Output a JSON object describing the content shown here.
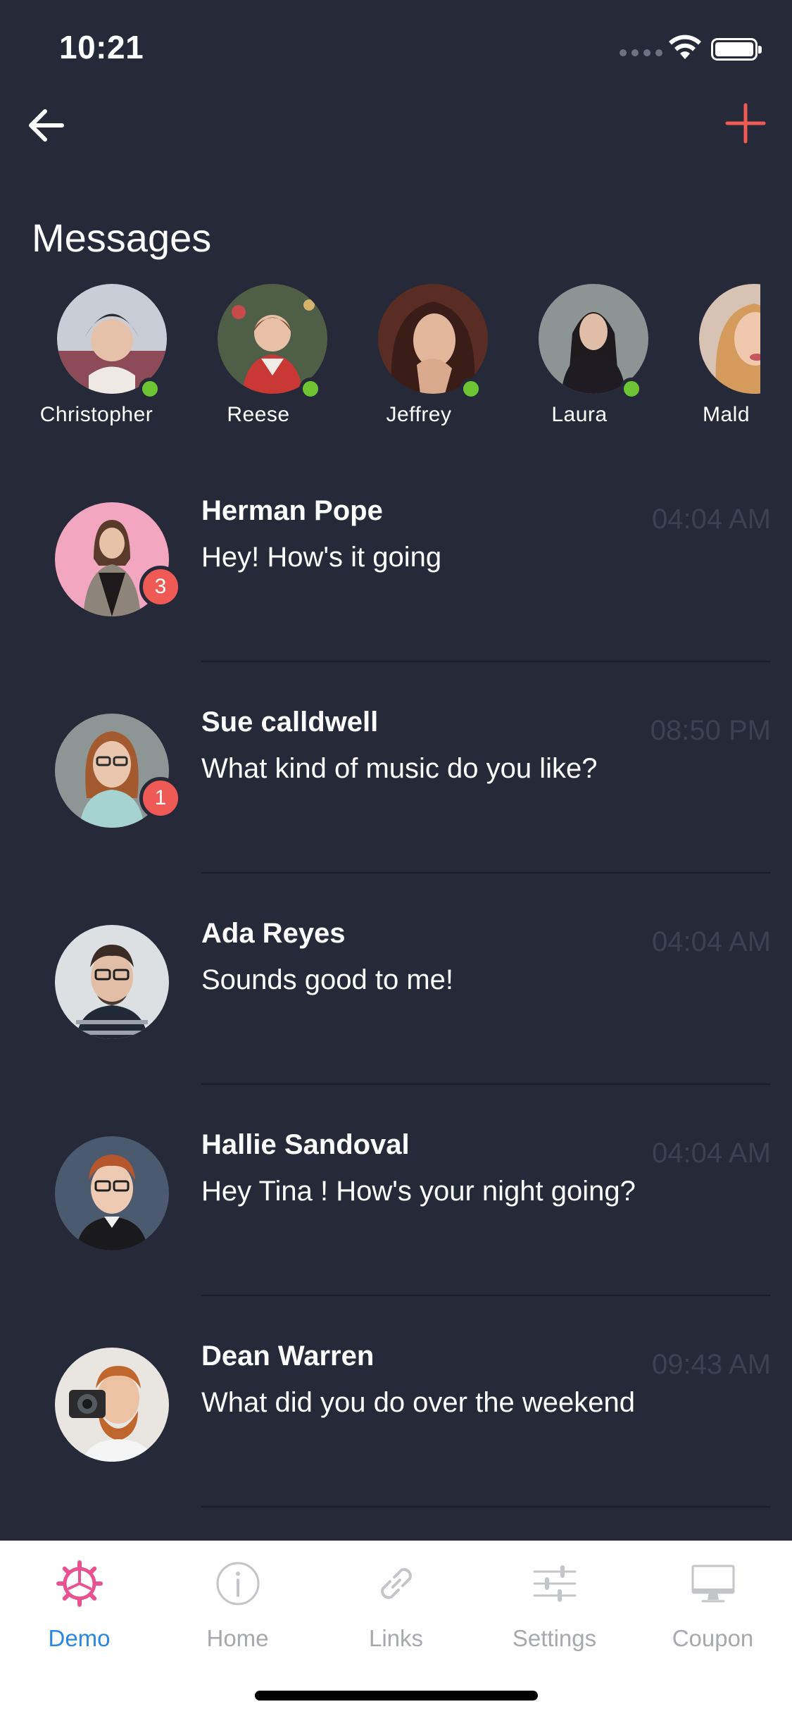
{
  "status_bar": {
    "time": "10:21"
  },
  "header": {
    "back_icon": "arrow-left-icon",
    "add_icon": "plus-icon",
    "accent_color": "#ef5a56"
  },
  "title": "Messages",
  "stories": [
    {
      "name": "Christopher",
      "online": true
    },
    {
      "name": "Reese",
      "online": true
    },
    {
      "name": "Jeffrey",
      "online": true
    },
    {
      "name": "Laura",
      "online": true
    },
    {
      "name": "Mald",
      "online": false
    }
  ],
  "conversations": [
    {
      "name": "Herman Pope",
      "message": "Hey! How's it going",
      "time": "04:04 AM",
      "unread": "3"
    },
    {
      "name": "Sue calldwell",
      "message": "What kind of music do you like?",
      "time": "08:50 PM",
      "unread": "1"
    },
    {
      "name": "Ada Reyes",
      "message": "Sounds good to me!",
      "time": "04:04 AM",
      "unread": ""
    },
    {
      "name": "Hallie Sandoval",
      "message": "Hey Tina ! How's your night going?",
      "time": "04:04 AM",
      "unread": ""
    },
    {
      "name": "Dean Warren",
      "message": "What did you do over the weekend",
      "time": "09:43 AM",
      "unread": ""
    }
  ],
  "tabs": [
    {
      "label": "Demo",
      "icon": "gear-icon",
      "active": true
    },
    {
      "label": "Home",
      "icon": "info-icon",
      "active": false
    },
    {
      "label": "Links",
      "icon": "link-icon",
      "active": false
    },
    {
      "label": "Settings",
      "icon": "sliders-icon",
      "active": false
    },
    {
      "label": "Coupon",
      "icon": "monitor-icon",
      "active": false
    }
  ],
  "colors": {
    "background": "#262938",
    "online": "#6dc534",
    "badge": "#ef5a56",
    "tab_active": "#2c86e5",
    "tab_inactive": "#a8a9ae",
    "time_text": "#3c4050"
  }
}
